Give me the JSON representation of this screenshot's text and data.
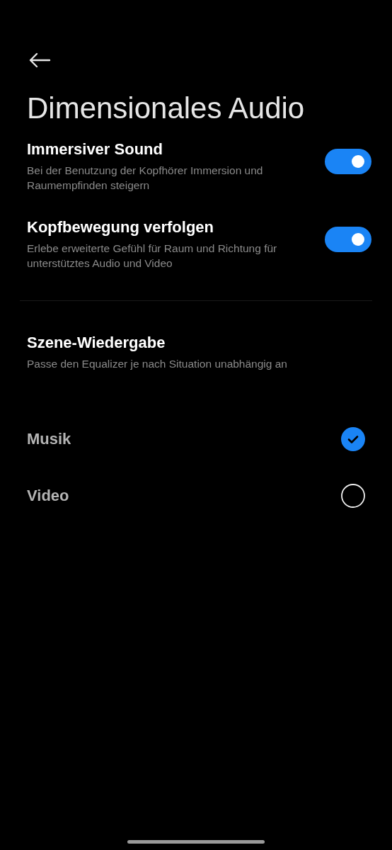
{
  "header": {
    "title": "Dimensionales Audio"
  },
  "toggles": [
    {
      "label": "Immersiver Sound",
      "description": "Bei der Benutzung der Kopfhörer Immersion und Raumempfinden steigern",
      "on": true
    },
    {
      "label": "Kopfbewegung verfolgen",
      "description": "Erlebe erweiterte Gefühl für Raum und Richtung für unterstütztes Audio und Video",
      "on": true
    }
  ],
  "scene": {
    "title": "Szene-Wiedergabe",
    "description": "Passe den Equalizer je nach Situation unabhängig an"
  },
  "options": [
    {
      "label": "Musik",
      "selected": true
    },
    {
      "label": "Video",
      "selected": false
    }
  ]
}
